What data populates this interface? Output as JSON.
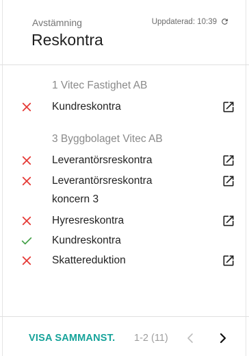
{
  "header": {
    "overline": "Avstämning",
    "title": "Reskontra",
    "updated": "Uppdaterad: 10:39"
  },
  "groups": [
    {
      "company": "1 Vitec Fastighet AB",
      "items": [
        {
          "label": "Kundreskontra",
          "status": "error",
          "open_link": true
        }
      ]
    },
    {
      "company": "3 Byggbolaget Vitec AB",
      "items": [
        {
          "label": "Leverantörsreskontra",
          "status": "error",
          "open_link": true
        },
        {
          "label_line1": "Leverantörsreskontra",
          "label_line2": "koncern 3",
          "status": "error",
          "open_link": true
        },
        {
          "label": "Hyresreskontra",
          "status": "error",
          "open_link": true
        },
        {
          "label": "Kundreskontra",
          "status": "ok",
          "open_link": false
        },
        {
          "label": "Skattereduktion",
          "status": "error",
          "open_link": true
        }
      ]
    }
  ],
  "footer": {
    "summary_label": "VISA SAMMANST.",
    "page_info": "1-2 (11)"
  },
  "colors": {
    "error": "#e53935",
    "ok": "#43a047",
    "accent": "#16a39a"
  },
  "icons": {
    "error": "close-x-icon",
    "ok": "checkmark-icon",
    "open": "open-in-new-icon",
    "refresh": "refresh-icon",
    "prev": "chevron-left-icon",
    "next": "chevron-right-icon"
  }
}
